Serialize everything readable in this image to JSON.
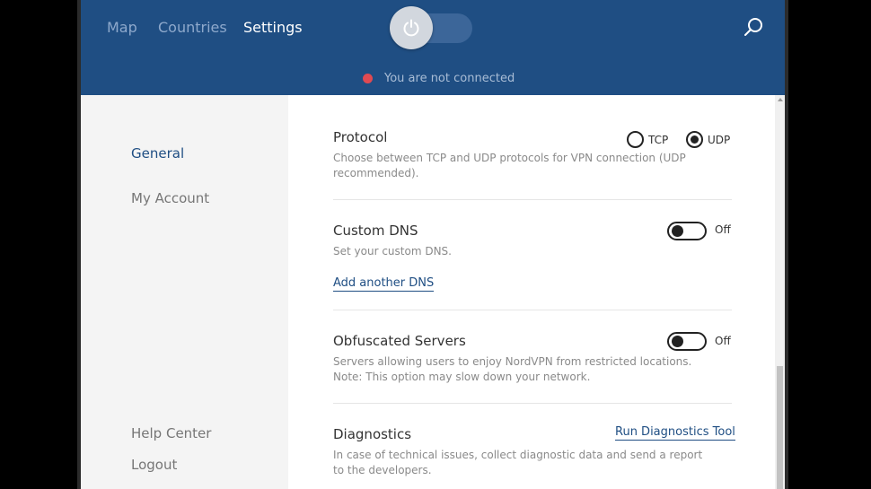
{
  "nav": {
    "tabs": [
      {
        "label": "Map"
      },
      {
        "label": "Countries"
      },
      {
        "label": "Settings"
      }
    ]
  },
  "status": {
    "text": "You are not connected",
    "dot_color": "#e04a52"
  },
  "sidebar": {
    "items": [
      {
        "label": "General"
      },
      {
        "label": "My Account"
      },
      {
        "label": "Help Center"
      },
      {
        "label": "Logout"
      }
    ]
  },
  "settings": {
    "protocol": {
      "title": "Protocol",
      "description": "Choose between TCP and UDP protocols for VPN connection (UDP recommended).",
      "options": [
        "TCP",
        "UDP"
      ],
      "selected": "UDP"
    },
    "custom_dns": {
      "title": "Custom DNS",
      "description": "Set your custom DNS.",
      "state": "Off",
      "link": "Add another DNS"
    },
    "obfuscated": {
      "title": "Obfuscated Servers",
      "description": "Servers allowing users to enjoy NordVPN from restricted locations. Note: This option may slow down your network.",
      "state": "Off"
    },
    "diagnostics": {
      "title": "Diagnostics",
      "description": "In case of technical issues, collect diagnostic data and send a report to the developers.",
      "link": "Run Diagnostics Tool"
    }
  },
  "colors": {
    "header": "#1f4e83",
    "accent": "#1f4e83",
    "sidebar": "#f4f4f4"
  },
  "icons": [
    "power-icon",
    "search-icon"
  ]
}
